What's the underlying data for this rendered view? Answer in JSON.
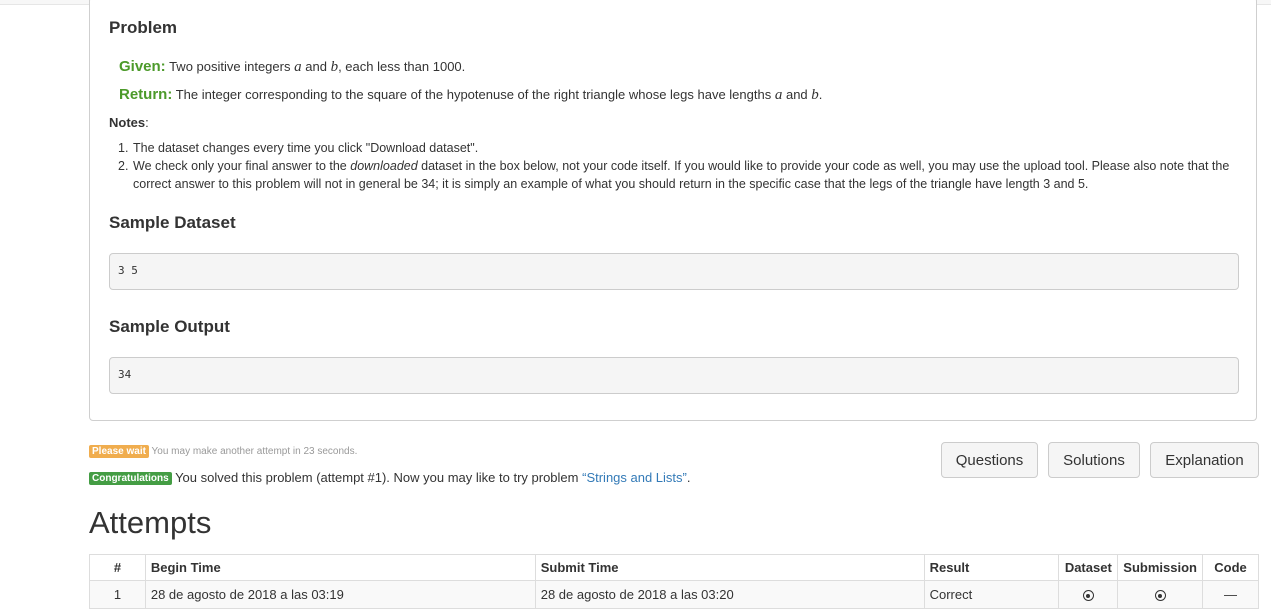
{
  "problem": {
    "heading": "Problem",
    "given_label": "Given:",
    "given_pre": "Two positive integers",
    "given_var_a": "a",
    "given_and": "and",
    "given_var_b": "b",
    "given_post": ", each less than 1000.",
    "return_label": "Return:",
    "return_pre": "The integer corresponding to the square of the hypotenuse of the right triangle whose legs have lengths",
    "return_var_a": "a",
    "return_and": "and",
    "return_var_b": "b",
    "return_post": ".",
    "notes_label": "Notes",
    "notes_colon": ":",
    "notes": [
      {
        "num": "1.",
        "text": "The dataset changes every time you click \"Download dataset\"."
      },
      {
        "num": "2.",
        "pre": "We check only your final answer to the ",
        "em": "downloaded",
        "post": " dataset in the box below, not your code itself. If you would like to provide your code as well, you may use the upload tool. Please also note that the correct answer to this problem will not in general be 34; it is simply an example of what you should return in the specific case that the legs of the triangle have length 3 and 5."
      }
    ],
    "sample_dataset_heading": "Sample Dataset",
    "sample_dataset": "3 5",
    "sample_output_heading": "Sample Output",
    "sample_output": "34"
  },
  "status": {
    "wait_badge": "Please wait",
    "wait_text": "You may make another attempt in 23 seconds.",
    "congrats_badge": "Congratulations",
    "congrats_text": "You solved this problem (attempt #1). Now you may like to try problem",
    "next_problem_link": "“Strings and Lists”",
    "congrats_end": "."
  },
  "buttons": {
    "questions": "Questions",
    "solutions": "Solutions",
    "explanation": "Explanation"
  },
  "attempts": {
    "heading": "Attempts",
    "columns": [
      "#",
      "Begin Time",
      "Submit Time",
      "Result",
      "Dataset",
      "Submission",
      "Code"
    ],
    "rows": [
      {
        "num": "1",
        "begin": "28 de agosto de 2018 a las 03:19",
        "submit": "28 de agosto de 2018 a las 03:20",
        "result": "Correct",
        "dataset_icon": "download-icon",
        "submission_icon": "download-icon",
        "code": "—"
      }
    ]
  },
  "colors": {
    "green_label": "#4c9a2a",
    "warn_badge": "#f0ad4e",
    "ok_badge": "#449d44",
    "link": "#337ab7"
  }
}
